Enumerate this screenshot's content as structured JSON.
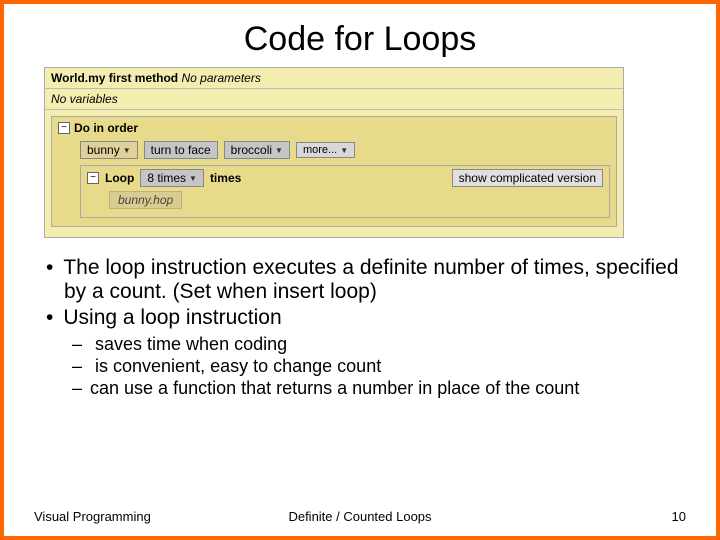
{
  "title": "Code for Loops",
  "code": {
    "header_label": "World.my first method",
    "header_params": "No parameters",
    "vars": "No variables",
    "do_in_order": "Do in order",
    "row1": {
      "obj": "bunny",
      "action": "turn to face",
      "param": "broccoli",
      "more": "more..."
    },
    "loop": {
      "label": "Loop",
      "count": "8 times",
      "times_word": "times",
      "show": "show complicated version",
      "call": "bunny.hop"
    }
  },
  "bullets": {
    "b1": "The loop instruction executes a definite number of times, specified by a count. (Set when insert loop)",
    "b2": "Using a loop instruction",
    "sub1": " saves time when coding",
    "sub2": " is convenient, easy to change count",
    "sub3": "can use a function that returns a number in place of the count"
  },
  "footer": {
    "left": "Visual Programming",
    "center": "Definite / Counted Loops",
    "page": "10"
  }
}
